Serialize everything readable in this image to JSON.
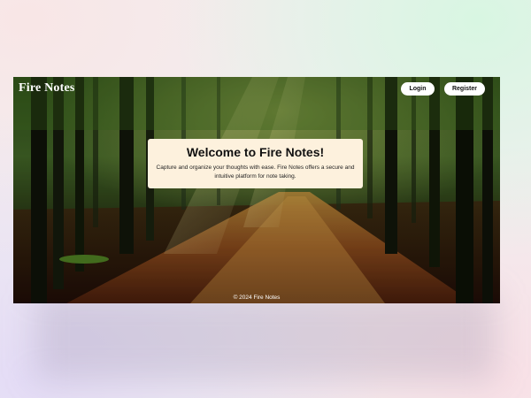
{
  "header": {
    "brand": "Fire Notes",
    "login_label": "Login",
    "register_label": "Register"
  },
  "hero": {
    "title": "Welcome to Fire Notes!",
    "description": "Capture and organize your thoughts with ease. Fire Notes offers a secure and intuitive platform for note taking."
  },
  "footer": {
    "text": "© 2024 Fire Notes"
  },
  "theme": {
    "card_background": "#fdf1dd",
    "button_background": "#ffffff",
    "brand_color": "#ffffff"
  }
}
